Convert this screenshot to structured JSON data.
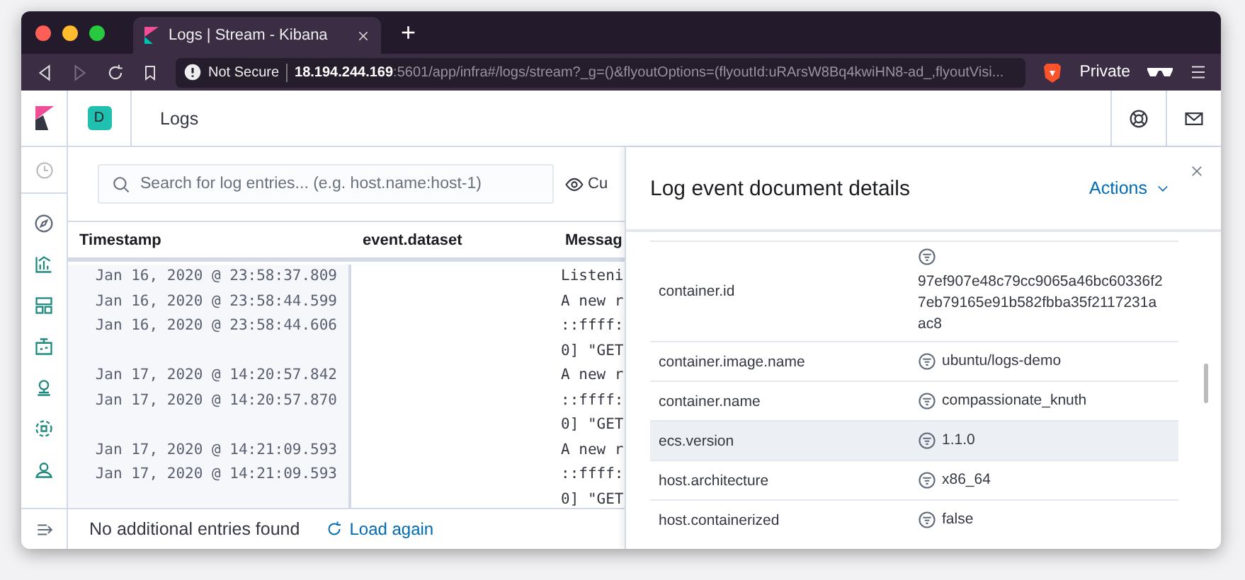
{
  "browser": {
    "tab_title": "Logs | Stream - Kibana",
    "new_tab": "+",
    "security": "Not Secure",
    "url_host": "18.194.244.169",
    "url_rest": ":5601/app/infra#/logs/stream?_g=()&flyoutOptions=(flyoutId:uRArsW8Bq4kwiHN8-ad_,flyoutVisi...",
    "private": "Private"
  },
  "header": {
    "space": "D",
    "title": "Logs"
  },
  "search": {
    "placeholder": "Search for log entries... (e.g. host.name:host-1)"
  },
  "customize_button": "Cu",
  "table": {
    "columns": [
      "Timestamp",
      "event.dataset",
      "Messag"
    ],
    "rows": [
      {
        "timestamp": "Jan 16, 2020 @ 23:58:37.809",
        "message": [
          "Listeni"
        ]
      },
      {
        "timestamp": "Jan 16, 2020 @ 23:58:44.599",
        "message": [
          "A new r"
        ]
      },
      {
        "timestamp": "Jan 16, 2020 @ 23:58:44.606",
        "message": [
          "::ffff:",
          "0] \"GET"
        ]
      },
      {
        "timestamp": "Jan 17, 2020 @ 14:20:57.842",
        "message": [
          "A new r"
        ]
      },
      {
        "timestamp": "Jan 17, 2020 @ 14:20:57.870",
        "message": [
          "::ffff:",
          "0] \"GET"
        ]
      },
      {
        "timestamp": "Jan 17, 2020 @ 14:21:09.593",
        "message": [
          "A new r"
        ]
      },
      {
        "timestamp": "Jan 17, 2020 @ 14:21:09.593",
        "message": [
          "::ffff:",
          "0] \"GET"
        ]
      }
    ]
  },
  "footer": {
    "status": "No additional entries found",
    "reload": "Load again"
  },
  "flyout": {
    "title": "Log event document details",
    "actions": "Actions",
    "fields": [
      {
        "field": "container.id",
        "value": "97ef907e48c79cc9065a46bc60336f27eb79165e91b582fbba35f2117231aac8",
        "highlighted": false
      },
      {
        "field": "container.image.name",
        "value": "ubuntu/logs-demo",
        "highlighted": false
      },
      {
        "field": "container.name",
        "value": "compassionate_knuth",
        "highlighted": false
      },
      {
        "field": "ecs.version",
        "value": "1.1.0",
        "highlighted": true
      },
      {
        "field": "host.architecture",
        "value": "x86_64",
        "highlighted": false
      },
      {
        "field": "host.containerized",
        "value": "false",
        "highlighted": false
      }
    ]
  }
}
